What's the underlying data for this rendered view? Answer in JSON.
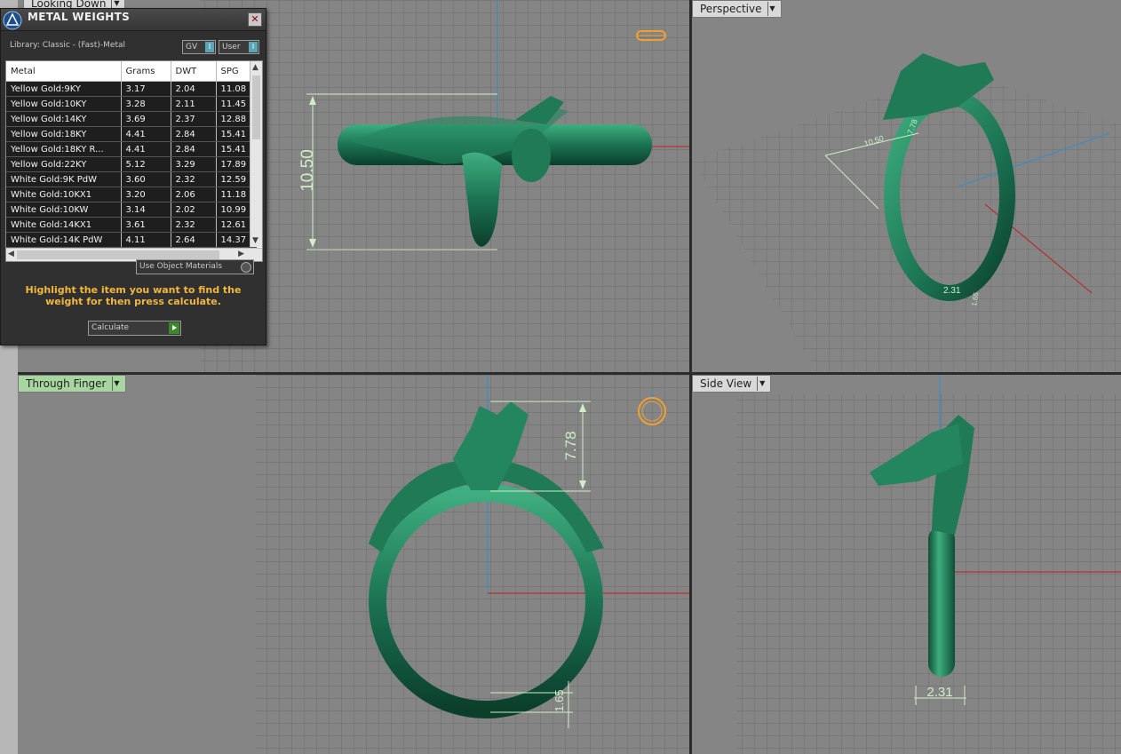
{
  "viewports": {
    "top_left": {
      "label": "Looking Down"
    },
    "top_right": {
      "label": "Perspective"
    },
    "bottom_left": {
      "label": "Through Finger"
    },
    "bottom_right": {
      "label": "Side View"
    }
  },
  "dimensions": {
    "height_top": "10.50",
    "persp_width": "10.50",
    "persp_height": "7.78",
    "persp_band": "2.31",
    "persp_band2": "1.65",
    "head_height": "7.78",
    "band_thickness": "1.65",
    "band_width": "2.31"
  },
  "panel": {
    "title": "METAL WEIGHTS",
    "library": "Library: Classic - (Fast)-Metal",
    "toggle_gv": "GV",
    "toggle_user": "User",
    "columns": [
      "Metal",
      "Grams",
      "DWT",
      "SPG"
    ],
    "rows": [
      [
        "Yellow Gold:9KY",
        "3.17",
        "2.04",
        "11.08"
      ],
      [
        "Yellow Gold:10KY",
        "3.28",
        "2.11",
        "11.45"
      ],
      [
        "Yellow Gold:14KY",
        "3.69",
        "2.37",
        "12.88"
      ],
      [
        "Yellow Gold:18KY",
        "4.41",
        "2.84",
        "15.41"
      ],
      [
        "Yellow Gold:18KY R...",
        "4.41",
        "2.84",
        "15.41"
      ],
      [
        "Yellow Gold:22KY",
        "5.12",
        "3.29",
        "17.89"
      ],
      [
        "White Gold:9K PdW",
        "3.60",
        "2.32",
        "12.59"
      ],
      [
        "White Gold:10KX1",
        "3.20",
        "2.06",
        "11.18"
      ],
      [
        "White Gold:10KW",
        "3.14",
        "2.02",
        "10.99"
      ],
      [
        "White Gold:14KX1",
        "3.61",
        "2.32",
        "12.61"
      ],
      [
        "White Gold:14K PdW",
        "4.11",
        "2.64",
        "14.37"
      ]
    ],
    "use_object_materials": "Use Object Materials",
    "hint": "Highlight the item you want to find the weight for then press calculate.",
    "calculate_label": "Calculate"
  },
  "colors": {
    "ring": "#1f7a55",
    "dimension": "#cfeec5",
    "grid": "#6e6e6e",
    "axis_red": "#c01e1e",
    "axis_blue": "#2f8fd0",
    "hint": "#f3b73c"
  }
}
